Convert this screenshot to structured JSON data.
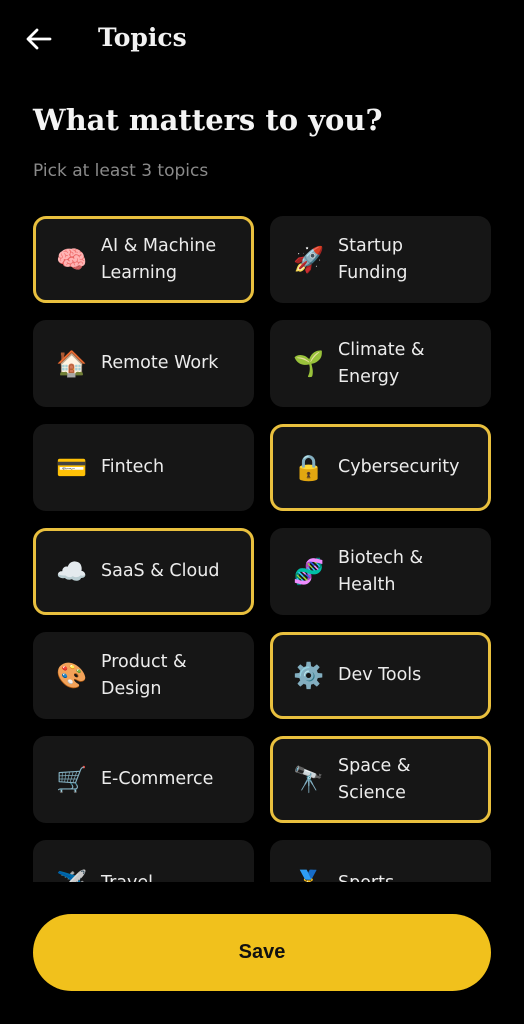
{
  "header": {
    "back_icon": "arrow-left-icon",
    "title": "Topics"
  },
  "intro": {
    "heading": "What matters to you?",
    "subheading": "Pick at least 3 topics"
  },
  "topics": [
    {
      "emoji": "🧠",
      "label": "AI & Machine Learning",
      "selected": true
    },
    {
      "emoji": "🚀",
      "label": "Startup Funding",
      "selected": false
    },
    {
      "emoji": "🏠",
      "label": "Remote Work",
      "selected": false
    },
    {
      "emoji": "🌱",
      "label": "Climate & Energy",
      "selected": false
    },
    {
      "emoji": "💳",
      "label": "Fintech",
      "selected": false
    },
    {
      "emoji": "🔒",
      "label": "Cybersecurity",
      "selected": true
    },
    {
      "emoji": "☁️",
      "label": "SaaS & Cloud",
      "selected": true
    },
    {
      "emoji": "🧬",
      "label": "Biotech & Health",
      "selected": false
    },
    {
      "emoji": "🎨",
      "label": "Product & Design",
      "selected": false
    },
    {
      "emoji": "⚙️",
      "label": "Dev Tools",
      "selected": true
    },
    {
      "emoji": "🛒",
      "label": "E-Commerce",
      "selected": false
    },
    {
      "emoji": "🔭",
      "label": "Space & Science",
      "selected": true
    },
    {
      "emoji": "✈️",
      "label": "Travel",
      "selected": false
    },
    {
      "emoji": "🏅",
      "label": "Sports",
      "selected": false
    }
  ],
  "colors": {
    "accent": "#f1c11c",
    "selected_border": "#e9c03e",
    "card_bg": "#161616",
    "page_bg": "#000000"
  },
  "footer": {
    "save_label": "Save"
  }
}
